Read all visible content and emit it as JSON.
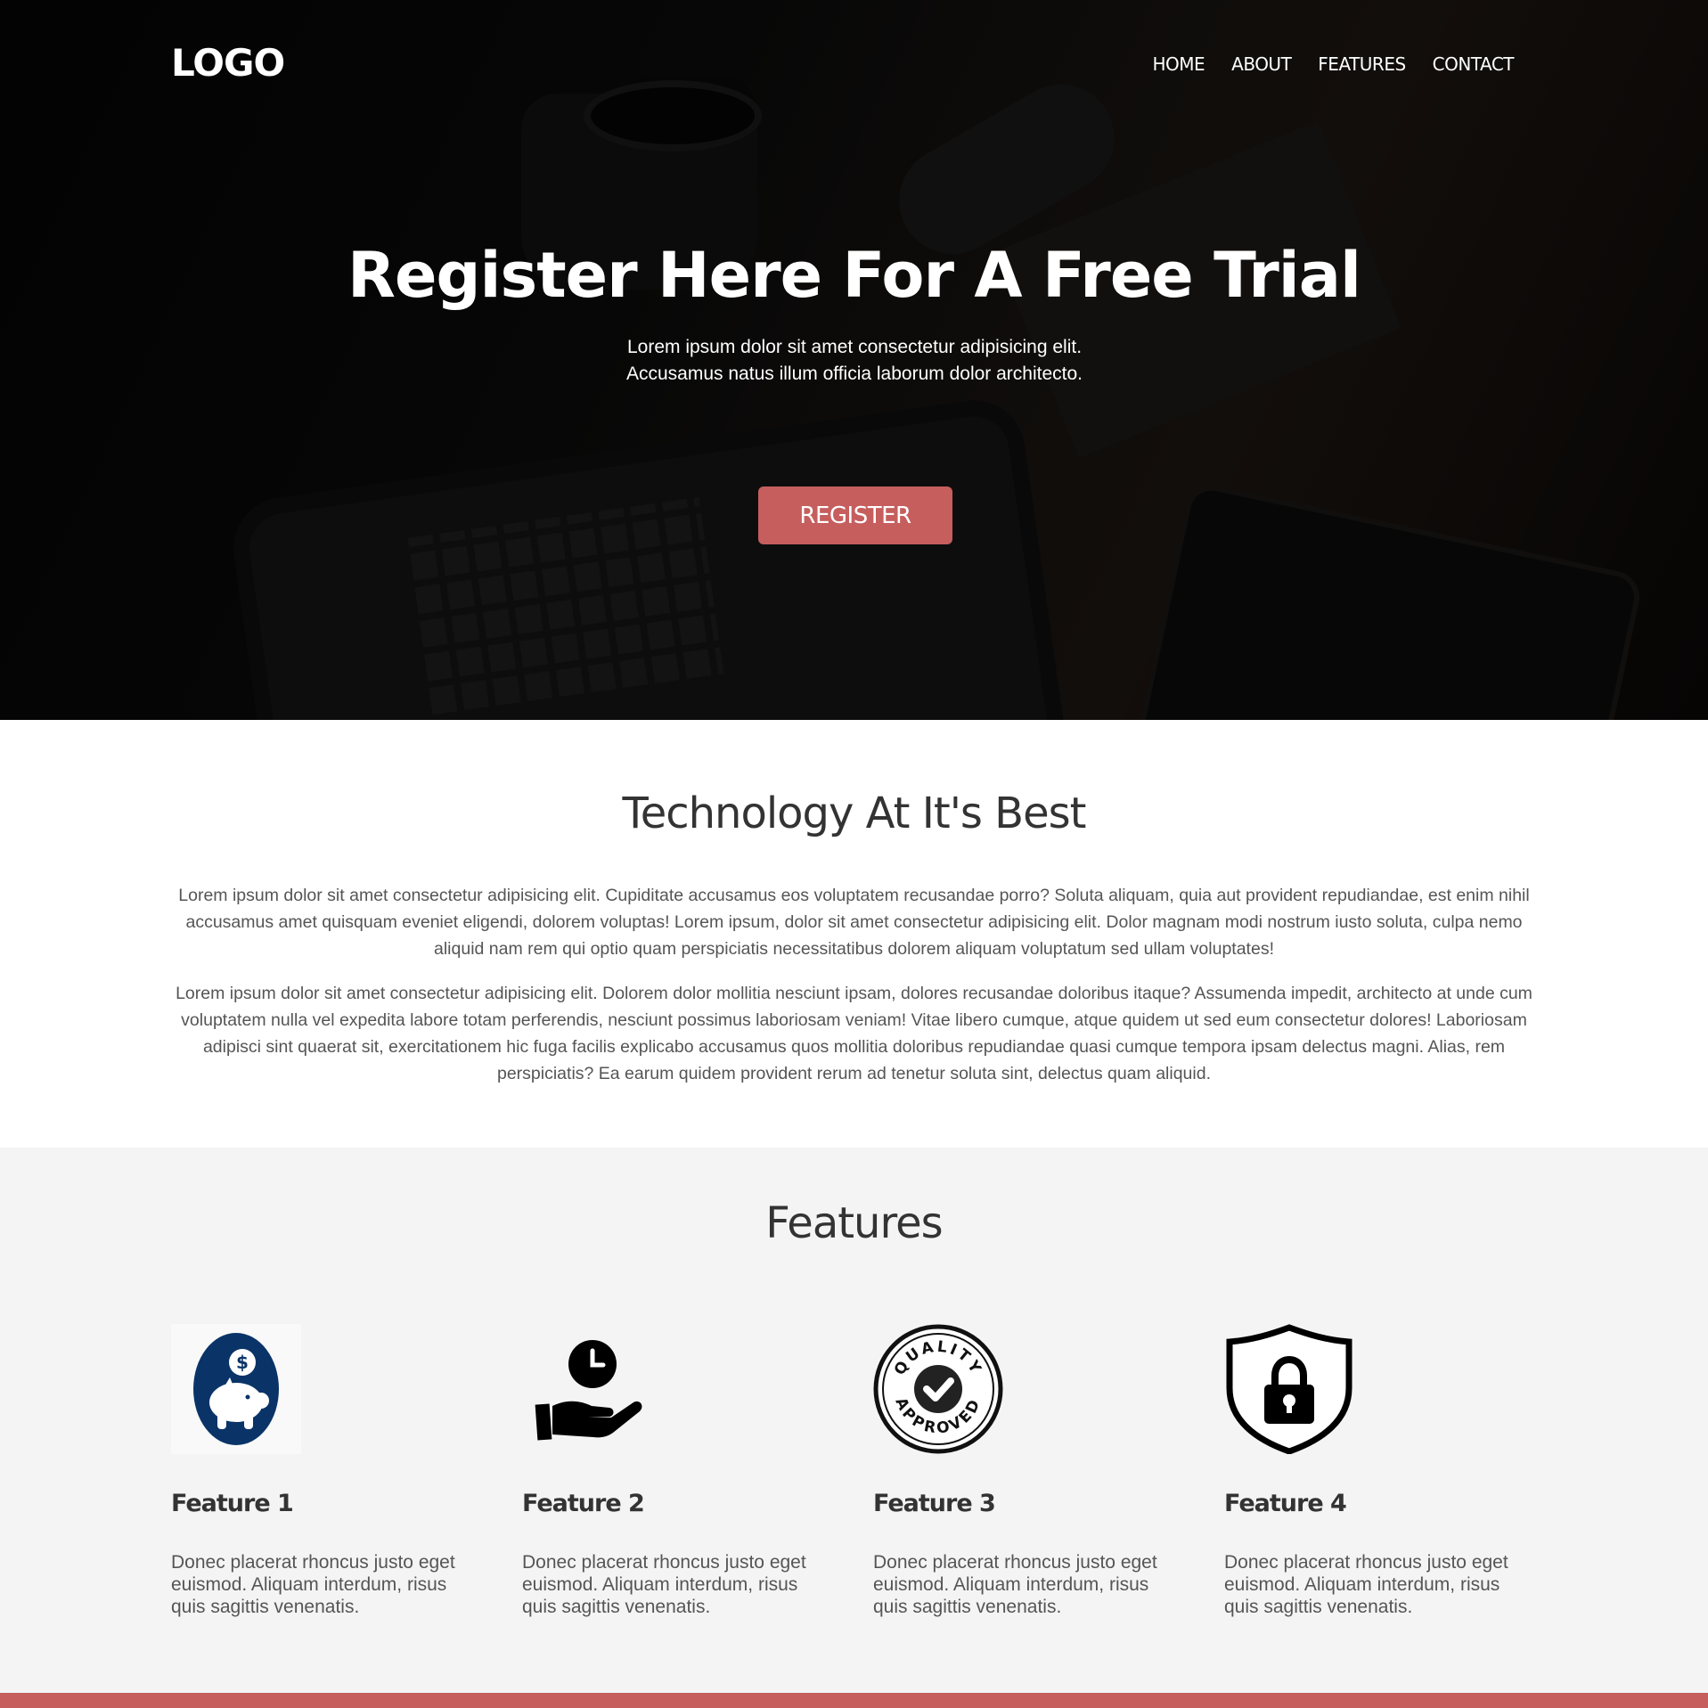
{
  "header": {
    "logo": "LOGO",
    "nav": [
      "HOME",
      "ABOUT",
      "FEATURES",
      "CONTACT"
    ]
  },
  "hero": {
    "title": "Register Here For A Free Trial",
    "text": "Lorem ipsum dolor sit amet consectetur adipisicing elit. Accusamus natus illum officia laborum dolor architecto.",
    "button": "REGISTER"
  },
  "tech": {
    "title": "Technology At It's Best",
    "paragraph1": "Lorem ipsum dolor sit amet consectetur adipisicing elit. Cupiditate accusamus eos voluptatem recusandae porro? Soluta aliquam, quia aut provident repudiandae, est enim nihil accusamus amet quisquam eveniet eligendi, dolorem voluptas! Lorem ipsum, dolor sit amet consectetur adipisicing elit. Dolor magnam modi nostrum iusto soluta, culpa nemo aliquid nam rem qui optio quam perspiciatis necessitatibus dolorem aliquam voluptatum sed ullam voluptates!",
    "paragraph2": "Lorem ipsum dolor sit amet consectetur adipisicing elit. Dolorem dolor mollitia nesciunt ipsam, dolores recusandae doloribus itaque? Assumenda impedit, architecto at unde cum voluptatem nulla vel expedita labore totam perferendis, nesciunt possimus laboriosam veniam! Vitae libero cumque, atque quidem ut sed eum consectetur dolores! Laboriosam adipisci sint quaerat sit, exercitationem hic fuga facilis explicabo accusamus quos mollitia doloribus repudiandae quasi cumque tempora ipsam delectus magni. Alias, rem perspiciatis? Ea earum quidem provident rerum ad tenetur soluta sint, delectus quam aliquid."
  },
  "features": {
    "title": "Features",
    "items": [
      {
        "icon": "piggy-bank-icon",
        "title": "Feature 1",
        "text": "Donec placerat rhoncus justo eget euismod. Aliquam interdum, risus quis sagittis venenatis."
      },
      {
        "icon": "hand-clock-icon",
        "title": "Feature 2",
        "text": "Donec placerat rhoncus justo eget euismod. Aliquam interdum, risus quis sagittis venenatis."
      },
      {
        "icon": "quality-approved-icon",
        "title": "Feature 3",
        "text": "Donec placerat rhoncus justo eget euismod. Aliquam interdum, risus quis sagittis venenatis."
      },
      {
        "icon": "shield-lock-icon",
        "title": "Feature 4",
        "text": "Donec placerat rhoncus justo eget euismod. Aliquam interdum, risus quis sagittis venenatis."
      }
    ],
    "badge_top_text": "QUALITY",
    "badge_bottom_text": "APPROVED",
    "piggy_bank_symbol": "$"
  },
  "colors": {
    "accent": "#c65e5e",
    "piggy_bank": "#0a3468",
    "section_bg": "#f4f4f4"
  }
}
